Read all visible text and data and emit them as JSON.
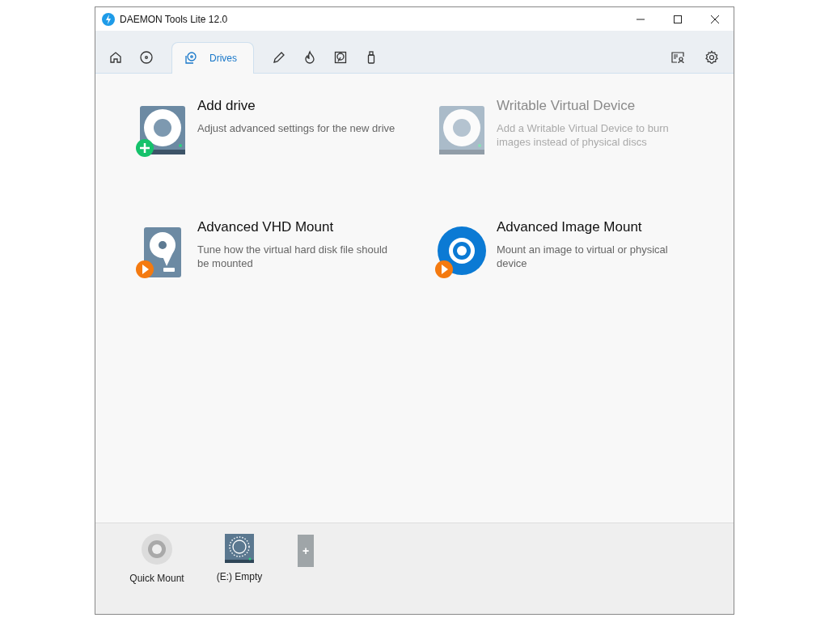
{
  "window": {
    "title": "DAEMON Tools Lite 12.0"
  },
  "tabs": [
    {
      "kind": "home",
      "selected": false
    },
    {
      "kind": "disc",
      "selected": false
    },
    {
      "kind": "drives",
      "label": "Drives",
      "selected": true
    },
    {
      "kind": "pencil",
      "selected": false
    },
    {
      "kind": "flame",
      "selected": false
    },
    {
      "kind": "disk",
      "selected": false
    },
    {
      "kind": "usb",
      "selected": false
    }
  ],
  "actions": [
    {
      "kind": "add",
      "title": "Add drive",
      "description": "Adjust advanced settings for the new drive",
      "disabled": false
    },
    {
      "kind": "writable",
      "title": "Writable Virtual Device",
      "description": "Add a Writable Virtual Device to burn images instead of physical discs",
      "disabled": true
    },
    {
      "kind": "vhd",
      "title": "Advanced VHD Mount",
      "description": "Tune how the virtual hard disk file should be mounted",
      "disabled": false
    },
    {
      "kind": "image",
      "title": "Advanced Image Mount",
      "description": "Mount an image to virtual or physical device",
      "disabled": false
    }
  ],
  "dock": [
    {
      "kind": "quick",
      "label": "Quick Mount"
    },
    {
      "kind": "drive",
      "label": "(E:) Empty"
    },
    {
      "kind": "add",
      "label": "+"
    }
  ]
}
